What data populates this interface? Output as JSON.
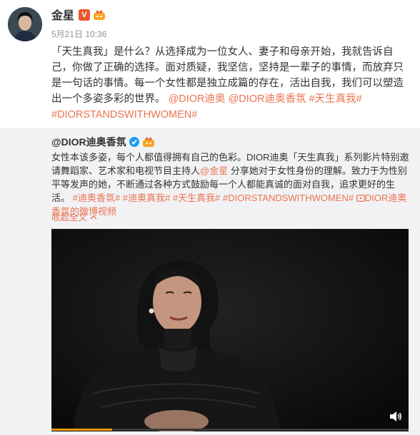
{
  "author": {
    "name": "金星",
    "time": "5月21日 10:36"
  },
  "post": {
    "text": "「天生真我」是什么？从选择成为一位女人、妻子和母亲开始，我就告诉自己，你做了正确的选择。面对质疑，我坚信，坚持是一辈子的事情，而放弃只是一句话的事情。每一个女性都是独立成篇的存在，活出自我，我们可以塑造出一个多姿多彩的世界。",
    "mention1": "@DIOR迪奥",
    "mention2": "@DIOR迪奥香氛",
    "tag1": "#天生真我#",
    "tag2": "#DIORSTANDSWITHWOMEN#"
  },
  "repost": {
    "author": "@DIOR迪奥香氛",
    "text_a": "女性本该多姿，每个人都值得拥有自己的色彩。DIOR迪奥「天生真我」系列影片特别邀请舞蹈家、艺术家和电视节目主持人",
    "mention": "@金星",
    "text_b": " 分享她对于女性身份的理解。致力于为性别平等发声的她，不断通过各种方式鼓励每一个人都能真诚的面对自我，追求更好的生活。",
    "tag1": "#迪奥香氛#",
    "tag2": "#迪奥真我#",
    "tag3": "#天生真我#",
    "tag4": "#DIORSTANDSWITHWOMEN#",
    "video_link": "DIOR迪奥香氛的微博视频",
    "collapse": "收起全文"
  },
  "video": {
    "progress": 0.17
  },
  "colors": {
    "link": "#eb7350",
    "repost_bg": "#f2f2f5",
    "progress": "#f39800",
    "verified": "#e9562c"
  },
  "icons": [
    "verified-badge-icon",
    "crown-badge-icon",
    "blue-verified-icon",
    "video-link-icon",
    "chevron-up-icon",
    "volume-icon"
  ]
}
